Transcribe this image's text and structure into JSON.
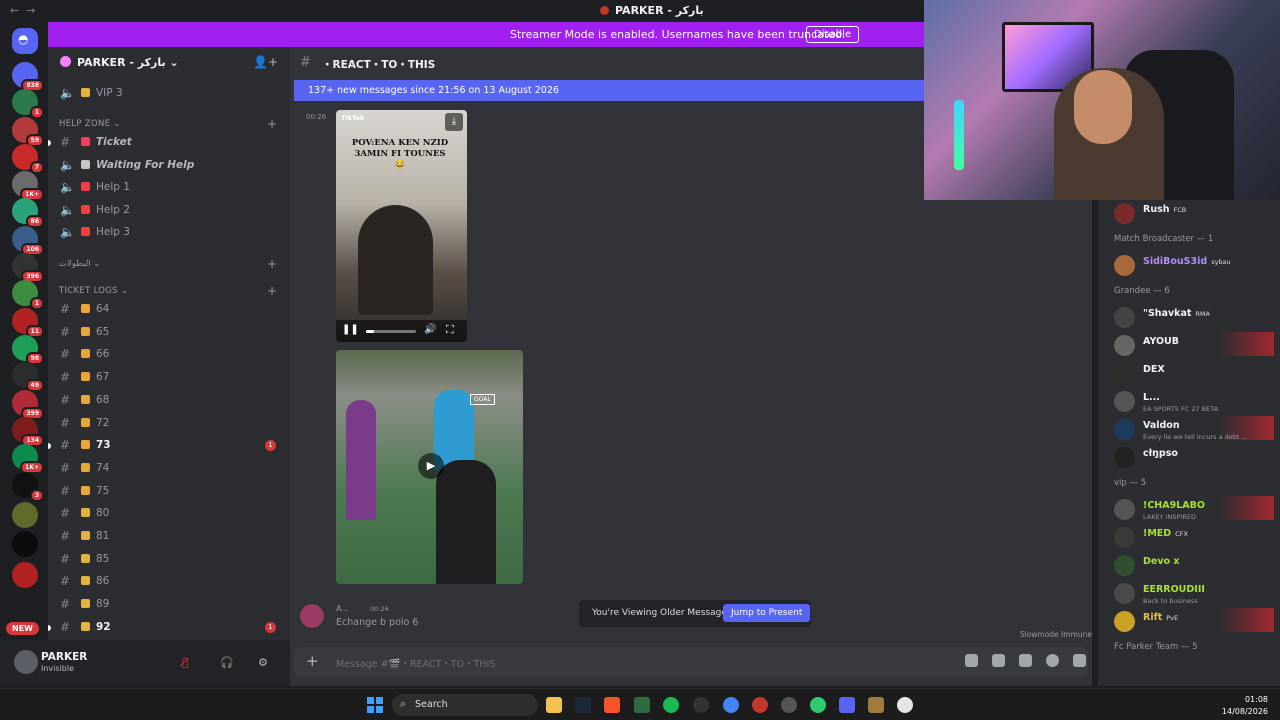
{
  "window": {
    "title": "PARKER - باركر"
  },
  "banner": {
    "text": "Streamer Mode is enabled. Usernames have been truncated.",
    "button": "Disable"
  },
  "rail": {
    "badges": [
      "838",
      "1",
      "59",
      "7",
      "1K+",
      "86",
      "106",
      "396",
      "1",
      "11",
      "98",
      "49",
      "399",
      "134",
      "1K+",
      "3"
    ],
    "new_label": "NEW",
    "colors": [
      "#5865f2",
      "#2c7a4b",
      "#b33a3a",
      "#c92a2a",
      "#6b6b6b",
      "#2aa37a",
      "#3b5d8a",
      "#333333",
      "#3f8b3f",
      "#b22222",
      "#1f9e5a",
      "#2d2d2d",
      "#b02a37",
      "#7f1d1d",
      "#0f8a4f",
      "#111111",
      "#5f6b2a",
      "#0c0c0c",
      "#b22222"
    ]
  },
  "sidebar": {
    "guild_name": "PARKER - باركر",
    "channels_top": [
      {
        "label": "VIP 3",
        "emoji_color": "#e2b341"
      }
    ],
    "categories": {
      "help": "HELP ZONE",
      "arabic": "البطولات",
      "logs": "TICKET LOGS"
    },
    "help_channels": [
      {
        "label": "Ticket",
        "emoji_color": "#f23f5d"
      },
      {
        "label": "Waiting For Help",
        "emoji_color": "#c6c6c6"
      },
      {
        "label": "Help 1",
        "emoji_color": "#f23f43"
      },
      {
        "label": "Help 2",
        "emoji_color": "#f23f43"
      },
      {
        "label": "Help 3",
        "emoji_color": "#f23f43"
      }
    ],
    "ticket_logs": [
      {
        "label": "64",
        "unread": false,
        "mention": ""
      },
      {
        "label": "65",
        "unread": false,
        "mention": ""
      },
      {
        "label": "66",
        "unread": false,
        "mention": ""
      },
      {
        "label": "67",
        "unread": false,
        "mention": ""
      },
      {
        "label": "68",
        "unread": false,
        "mention": ""
      },
      {
        "label": "72",
        "unread": false,
        "mention": ""
      },
      {
        "label": "73",
        "unread": true,
        "mention": "1"
      },
      {
        "label": "74",
        "unread": false,
        "mention": ""
      },
      {
        "label": "75",
        "unread": false,
        "mention": ""
      },
      {
        "label": "80",
        "unread": false,
        "mention": ""
      },
      {
        "label": "81",
        "unread": false,
        "mention": ""
      },
      {
        "label": "85",
        "unread": false,
        "mention": ""
      },
      {
        "label": "86",
        "unread": false,
        "mention": ""
      },
      {
        "label": "89",
        "unread": false,
        "mention": ""
      },
      {
        "label": "92",
        "unread": true,
        "mention": "1"
      }
    ]
  },
  "user": {
    "name": "PARKER",
    "status": "Invisible"
  },
  "chat": {
    "channel_name": "・REACT・TO・THIS",
    "new_messages": "137+ new messages since 21:56 on 13 August 2026",
    "timestamp": "00:26",
    "video1": {
      "source": "TikTok",
      "caption": "POV:ENA KEN NZID 3AMIN FI TOUNES 😂"
    },
    "video2": {
      "badge": "GOAL"
    },
    "msg2": {
      "author": "A...",
      "time": "00:26",
      "text": "Echange b polo 6"
    },
    "older_notice": "You're Viewing Older Messages",
    "jump_button": "Jump to Present",
    "slowmode": "Slowmode Immune",
    "composer_placeholder": "Message #🎬・REACT・TO・THIS"
  },
  "members": {
    "items": [
      {
        "name": "Rush",
        "tag": "FCB",
        "sub": "",
        "type": "member",
        "av": "#7b2a2a"
      },
      {
        "name": "Match Broadcaster — 1",
        "type": "group"
      },
      {
        "name": "SidiBouS3id",
        "tag": "sybau",
        "sub": "",
        "type": "member",
        "style": "purple",
        "av": "#a86a3a"
      },
      {
        "name": "Grandee — 6",
        "type": "group"
      },
      {
        "name": "\"Shavkat",
        "tag": "RMA",
        "sub": "",
        "type": "member",
        "av": "#444"
      },
      {
        "name": "AYOUB",
        "tag": "",
        "sub": "",
        "type": "member",
        "flag": true,
        "av": "#666"
      },
      {
        "name": "DEX",
        "tag": "",
        "sub": "",
        "type": "member",
        "av": "#2d2d2d"
      },
      {
        "name": "L...",
        "tag": "",
        "sub": "EA SPORTS FC 27 BETA",
        "type": "member",
        "av": "#555"
      },
      {
        "name": "Valdon",
        "tag": "",
        "sub": "Every lie we tell incurs a debt ...",
        "type": "member",
        "flag": true,
        "av": "#1d3b5c"
      },
      {
        "name": "cłŋpso",
        "tag": "",
        "sub": "",
        "type": "member",
        "av": "#222"
      },
      {
        "name": "vip — 5",
        "type": "group"
      },
      {
        "name": "!CHA9LABO",
        "tag": "",
        "sub": "LAKEY INSPIRED",
        "type": "member",
        "style": "green",
        "flag": true,
        "av": "#555"
      },
      {
        "name": "!MED",
        "tag": "CFX",
        "sub": "",
        "type": "member",
        "style": "green",
        "av": "#3a3a3a"
      },
      {
        "name": "Devo x",
        "tag": "",
        "sub": "",
        "type": "member",
        "style": "green",
        "av": "#2f4f2f"
      },
      {
        "name": "EERROUDIII",
        "tag": "",
        "sub": "Back to business",
        "type": "member",
        "style": "green",
        "av": "#4a4a4a"
      },
      {
        "name": "Rift",
        "tag": "PvE",
        "sub": "",
        "type": "member",
        "style": "gold",
        "flag": true,
        "av": "#c9a227"
      },
      {
        "name": "Fc Parker Team — 5",
        "type": "group"
      }
    ]
  },
  "taskbar": {
    "search_label": "Search",
    "time": "01:08",
    "date": "14/08/2026"
  },
  "accent": "#5865f2"
}
